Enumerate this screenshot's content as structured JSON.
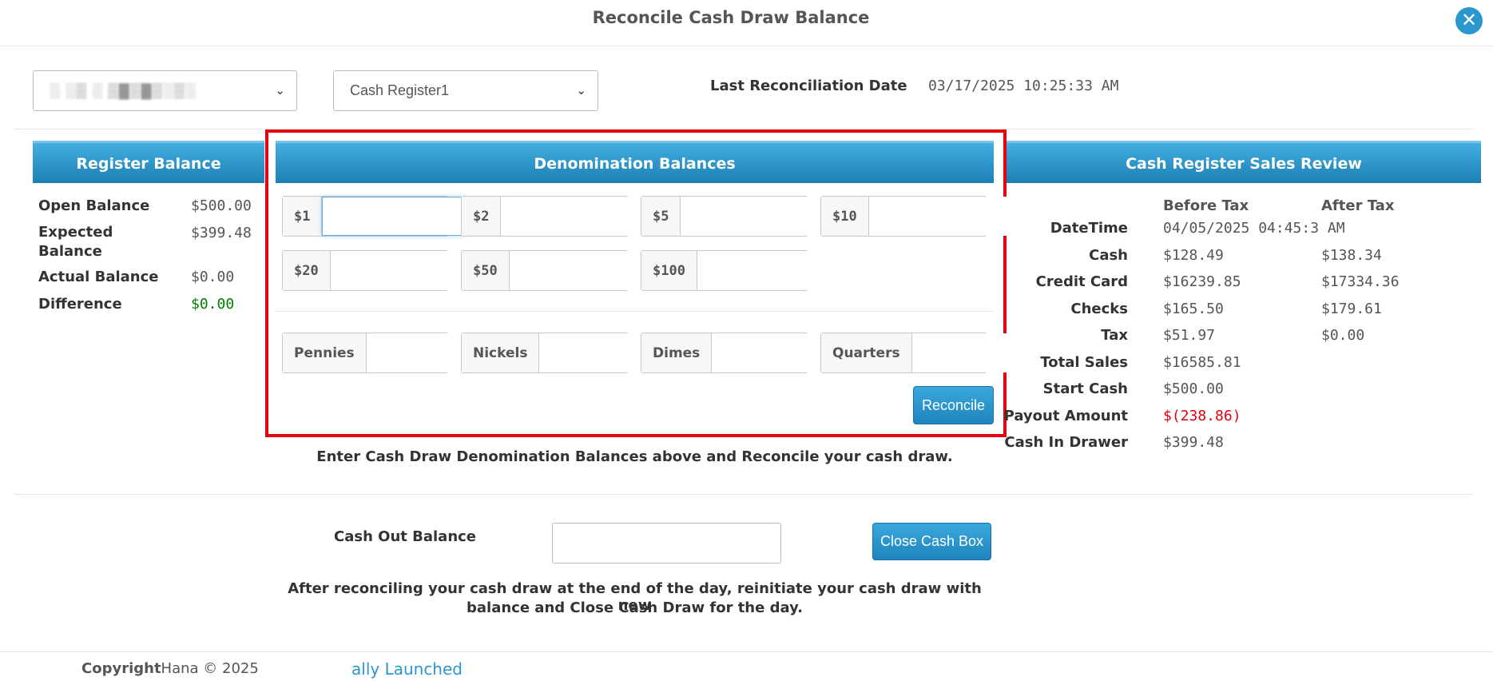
{
  "header": {
    "title": "Reconcile Cash Draw Balance",
    "close_icon": "close-icon",
    "close_glyph": "✕"
  },
  "top": {
    "store_select_value": "░ ░▒ ░ ▒▓▒▓▒░▒░",
    "register_select_value": "Cash Register1",
    "chevron_glyph": "⌄",
    "last_reconciliation_label": "Last Reconciliation Date",
    "last_reconciliation_value": "03/17/2025 10:25:33 AM"
  },
  "register_balance": {
    "title": "Register Balance",
    "rows": [
      {
        "label": "Open Balance",
        "value": "$500.00"
      },
      {
        "label": "Expected Balance",
        "value": "$399.48"
      },
      {
        "label": "Actual Balance",
        "value": "$0.00"
      },
      {
        "label": "Difference",
        "value": "$0.00"
      }
    ],
    "difference_color": "#008000"
  },
  "denomination": {
    "title": "Denomination Balances",
    "bills": [
      "$1",
      "$2",
      "$5",
      "$10",
      "$20",
      "$50",
      "$100"
    ],
    "coins": [
      "Pennies",
      "Nickels",
      "Dimes",
      "Quarters"
    ],
    "reconcile_label": "Reconcile",
    "help_text": "Enter Cash Draw Denomination Balances above and Reconcile your cash draw."
  },
  "sales_review": {
    "title": "Cash Register Sales Review",
    "col_before": "Before Tax",
    "col_after": "After Tax",
    "datetime_label": "DateTime",
    "datetime_value": "04/05/2025 04:45:3 AM",
    "rows": [
      {
        "label": "Cash",
        "before": "$128.49",
        "after": "$138.34"
      },
      {
        "label": "Credit Card",
        "before": "$16239.85",
        "after": "$17334.36"
      },
      {
        "label": "Checks",
        "before": "$165.50",
        "after": "$179.61"
      },
      {
        "label": "Tax",
        "before": "$51.97",
        "after": "$0.00"
      },
      {
        "label": "Total Sales",
        "before": "$16585.81",
        "after": ""
      },
      {
        "label": "Start Cash",
        "before": "$500.00",
        "after": ""
      },
      {
        "label": "Payout Amount",
        "before": "$(238.86)",
        "after": ""
      },
      {
        "label": "Cash In Drawer",
        "before": "$399.48",
        "after": ""
      }
    ],
    "payout_color": "#e3000f"
  },
  "cash_out": {
    "label": "Cash Out Balance",
    "value": "",
    "close_button_label": "Close Cash Box",
    "help_line1": "After reconciling your cash draw at the end of the day, reinitiate your cash draw with new",
    "help_line2": "balance and Close Cash Draw for the day."
  },
  "footer": {
    "copyright_bold": "Copyright",
    "copyright_rest": "Hana © 2025",
    "link_text": "ally Launched"
  },
  "colors": {
    "accent": "#2b97cf",
    "highlight_frame": "#e3000f"
  }
}
